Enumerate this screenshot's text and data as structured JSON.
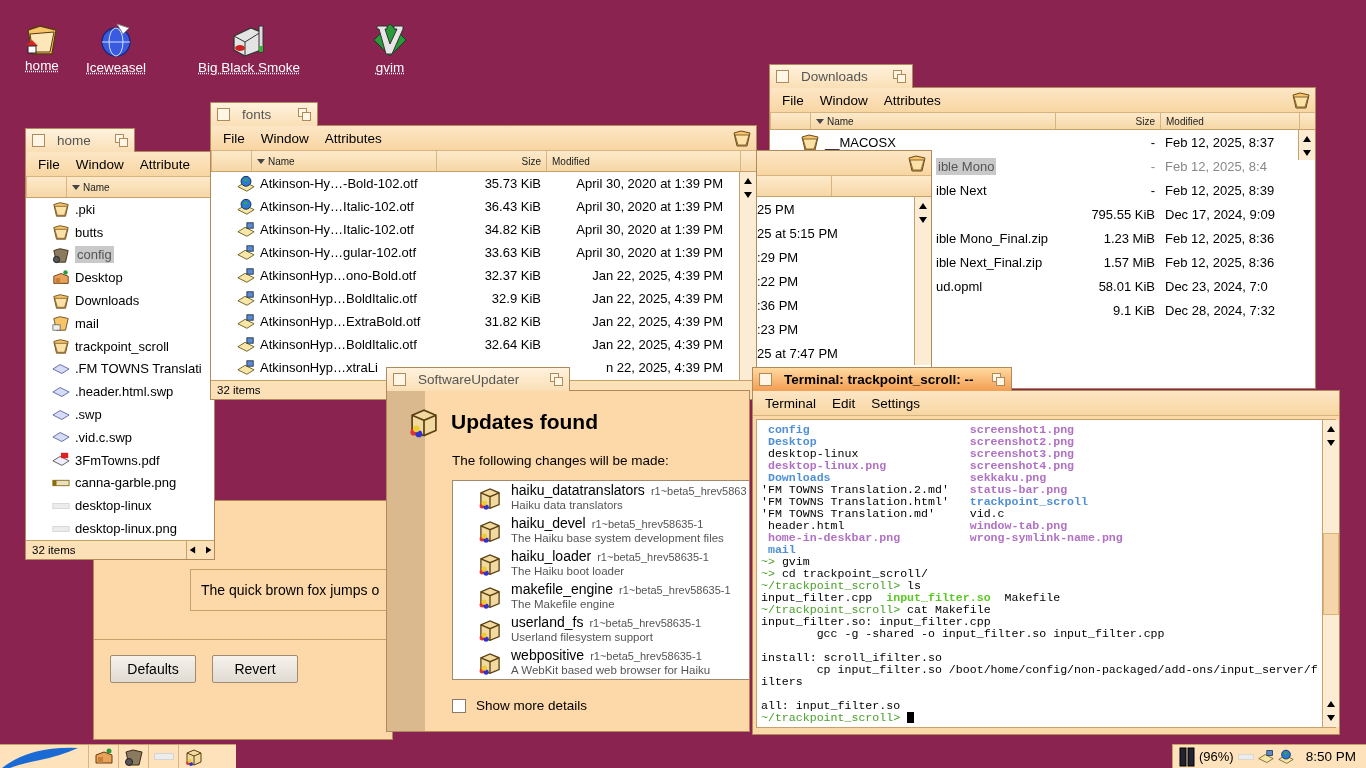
{
  "desktop_icons": [
    {
      "label": "home",
      "kind": "home-folder"
    },
    {
      "label": "Iceweasel",
      "kind": "globe"
    },
    {
      "label": "Big Black Smoke",
      "kind": "drive"
    },
    {
      "label": "gvim",
      "kind": "vim"
    }
  ],
  "font_window": {
    "sample_text": "The quick brown fox jumps o",
    "buttons": [
      "Defaults",
      "Revert"
    ]
  },
  "home_window": {
    "title": "home",
    "menu": [
      "File",
      "Window",
      "Attribute"
    ],
    "columns": [
      "Name"
    ],
    "status": "32 items",
    "items": [
      {
        "name": ".pki",
        "kind": "folder",
        "selected": false
      },
      {
        "name": "butts",
        "kind": "folder",
        "selected": false
      },
      {
        "name": "config",
        "kind": "gear-folder",
        "selected": true
      },
      {
        "name": "Desktop",
        "kind": "desk",
        "selected": false
      },
      {
        "name": "Downloads",
        "kind": "folder",
        "selected": false
      },
      {
        "name": "mail",
        "kind": "mail-folder",
        "selected": false
      },
      {
        "name": "trackpoint_scroll",
        "kind": "folder",
        "selected": false
      },
      {
        "name": ".FM TOWNS Translati",
        "kind": "document",
        "selected": false
      },
      {
        "name": ".header.html.swp",
        "kind": "document",
        "selected": false
      },
      {
        "name": ".swp",
        "kind": "document",
        "selected": false
      },
      {
        "name": ".vid.c.swp",
        "kind": "document",
        "selected": false
      },
      {
        "name": "3FmTowns.pdf",
        "kind": "pdf",
        "selected": false
      },
      {
        "name": "canna-garble.png",
        "kind": "image",
        "selected": false
      },
      {
        "name": "desktop-linux",
        "kind": "blank",
        "selected": false
      },
      {
        "name": "desktop-linux.png",
        "kind": "blank",
        "selected": false
      }
    ]
  },
  "downloads_window": {
    "title": "Downloads",
    "menu": [
      "File",
      "Window",
      "Attributes"
    ],
    "columns": [
      "Name",
      "Size",
      "Modified"
    ],
    "rows": [
      {
        "name": "__MACOSX",
        "kind": "folder",
        "size": "-",
        "modified": "Feb 12, 2025, 8:37",
        "selected": false
      },
      {
        "name": "ible Mono",
        "kind": "covered",
        "size": "-",
        "modified": "Feb 12, 2025, 8:4",
        "selected": true
      },
      {
        "name": "ible Next",
        "kind": "covered",
        "size": "-",
        "modified": "Feb 12, 2025, 8:39",
        "selected": false
      },
      {
        "kind": "covered",
        "size": "795.55 KiB",
        "modified": "Dec 17, 2024, 9:09",
        "selected": false
      },
      {
        "name": "ible Mono_Final.zip",
        "kind": "covered",
        "size": "1.23 MiB",
        "modified": "Feb 12, 2025, 8:36",
        "selected": false
      },
      {
        "name": "ible Next_Final.zip",
        "kind": "covered",
        "size": "1.57 MiB",
        "modified": "Feb 12, 2025, 8:36",
        "selected": false
      },
      {
        "name": "ud.opml",
        "kind": "covered",
        "size": "58.01 KiB",
        "modified": "Dec 23, 2024, 7:0",
        "selected": false
      },
      {
        "kind": "covered",
        "size": "9.1 KiB",
        "modified": "Dec 28, 2024, 7:32",
        "selected": false
      }
    ]
  },
  "background_window": {
    "rows": [
      "25 PM",
      "25 at 5:15 PM",
      ":29 PM",
      ":22 PM",
      ":36 PM",
      ":23 PM",
      "25 at 7:47 PM"
    ]
  },
  "fonts_window": {
    "title": "fonts",
    "menu": [
      "File",
      "Window",
      "Attributes"
    ],
    "columns": [
      "Name",
      "Size",
      "Modified"
    ],
    "status": "32 items",
    "rows": [
      {
        "name": "Atkinson-Hy…-Bold-102.otf",
        "kind": "globe-file",
        "size": "35.73 KiB",
        "modified": "April 30, 2020 at 1:39 PM"
      },
      {
        "name": "Atkinson-Hy…Italic-102.otf",
        "kind": "globe-file",
        "size": "36.43 KiB",
        "modified": "April 30, 2020 at 1:39 PM"
      },
      {
        "name": "Atkinson-Hy…Italic-102.otf",
        "kind": "font-file",
        "size": "34.82 KiB",
        "modified": "April 30, 2020 at 1:39 PM"
      },
      {
        "name": "Atkinson-Hy…gular-102.otf",
        "kind": "font-file",
        "size": "33.63 KiB",
        "modified": "April 30, 2020 at 1:39 PM"
      },
      {
        "name": "AtkinsonHyp…ono-Bold.otf",
        "kind": "font-file",
        "size": "32.37 KiB",
        "modified": "Jan 22, 2025, 4:39 PM"
      },
      {
        "name": "AtkinsonHyp…BoldItalic.otf",
        "kind": "font-file",
        "size": "32.9 KiB",
        "modified": "Jan 22, 2025, 4:39 PM"
      },
      {
        "name": "AtkinsonHyp…ExtraBold.otf",
        "kind": "font-file",
        "size": "31.82 KiB",
        "modified": "Jan 22, 2025, 4:39 PM"
      },
      {
        "name": "AtkinsonHyp…BoldItalic.otf",
        "kind": "font-file",
        "size": "32.64 KiB",
        "modified": "Jan 22, 2025, 4:39 PM"
      },
      {
        "name": "AtkinsonHyp…xtraLi",
        "kind": "font-file",
        "modified": "n 22, 2025, 4:39 PM"
      }
    ]
  },
  "software_updater": {
    "title": "SoftwareUpdater",
    "heading": "Updates found",
    "subtitle": "The following changes will be made:",
    "show_details": {
      "label": "Show more details",
      "checked": false
    },
    "packages": [
      {
        "name": "haiku_datatranslators",
        "version": "r1~beta5_hrev5863",
        "description": "Haiku data translators"
      },
      {
        "name": "haiku_devel",
        "version": "r1~beta5_hrev58635-1",
        "description": "The Haiku base system development files"
      },
      {
        "name": "haiku_loader",
        "version": "r1~beta5_hrev58635-1",
        "description": "The Haiku boot loader"
      },
      {
        "name": "makefile_engine",
        "version": "r1~beta5_hrev58635-1",
        "description": "The Makefile engine"
      },
      {
        "name": "userland_fs",
        "version": "r1~beta5_hrev58635-1",
        "description": "Userland filesystem support"
      },
      {
        "name": "webpositive",
        "version": "r1~beta5_hrev58635-1",
        "description": "A WebKit based web browser for Haiku"
      }
    ]
  },
  "terminal": {
    "title": "Terminal: trackpoint_scroll: --",
    "menu": [
      "Terminal",
      "Edit",
      "Settings"
    ],
    "listing": [
      {
        "left": {
          "text": "config",
          "kind": "dir"
        },
        "right": {
          "text": "screenshot1.png",
          "kind": "image"
        }
      },
      {
        "left": {
          "text": "Desktop",
          "kind": "dir"
        },
        "right": {
          "text": "screenshot2.png",
          "kind": "image"
        }
      },
      {
        "left": {
          "text": "desktop-linux",
          "kind": "plain"
        },
        "right": {
          "text": "screenshot3.png",
          "kind": "image"
        }
      },
      {
        "left": {
          "text": "desktop-linux.png",
          "kind": "image"
        },
        "right": {
          "text": "screenshot4.png",
          "kind": "image"
        }
      },
      {
        "left": {
          "text": "Downloads",
          "kind": "dir"
        },
        "right": {
          "text": "sekkaku.png",
          "kind": "image"
        }
      },
      {
        "left": {
          "text": "'FM TOWNS Translation.2.md'",
          "kind": "quoted"
        },
        "right": {
          "text": "status-bar.png",
          "kind": "image"
        }
      },
      {
        "left": {
          "text": "'FM TOWNS Translation.html'",
          "kind": "quoted"
        },
        "right": {
          "text": "trackpoint_scroll",
          "kind": "dir"
        }
      },
      {
        "left": {
          "text": "'FM TOWNS Translation.md'",
          "kind": "quoted"
        },
        "right": {
          "text": "vid.c",
          "kind": "plain"
        }
      },
      {
        "left": {
          "text": "header.html",
          "kind": "plain"
        },
        "right": {
          "text": "window-tab.png",
          "kind": "image"
        }
      },
      {
        "left": {
          "text": "home-in-deskbar.png",
          "kind": "image"
        },
        "right": {
          "text": "wrong-symlink-name.png",
          "kind": "image"
        }
      },
      {
        "left": {
          "text": "mail",
          "kind": "dir"
        }
      }
    ],
    "lines": [
      {
        "kind": "text",
        "segments": [
          {
            "text": "~>",
            "kind": "prompt"
          },
          {
            "text": " gvim",
            "kind": "plain"
          }
        ]
      },
      {
        "kind": "text",
        "segments": [
          {
            "text": "~>",
            "kind": "prompt"
          },
          {
            "text": " cd trackpoint_scroll/",
            "kind": "plain"
          }
        ]
      },
      {
        "kind": "text",
        "segments": [
          {
            "text": "~/trackpoint_scroll>",
            "kind": "prompt"
          },
          {
            "text": " ls",
            "kind": "plain"
          }
        ]
      },
      {
        "kind": "text",
        "segments": [
          {
            "text": "input_filter.cpp  ",
            "kind": "plain"
          },
          {
            "text": "input_filter.so",
            "kind": "exec"
          },
          {
            "text": "  Makefile",
            "kind": "plain"
          }
        ]
      },
      {
        "kind": "text",
        "segments": [
          {
            "text": "~/trackpoint_scroll>",
            "kind": "prompt"
          },
          {
            "text": " cat Makefile",
            "kind": "plain"
          }
        ]
      },
      {
        "kind": "text",
        "segments": [
          {
            "text": "input_filter.so: input_filter.cpp",
            "kind": "plain"
          }
        ]
      },
      {
        "kind": "text",
        "segments": [
          {
            "text": "        gcc -g -shared -o input_filter.so input_filter.cpp",
            "kind": "plain"
          }
        ]
      },
      {
        "kind": "blank"
      },
      {
        "kind": "text",
        "segments": [
          {
            "text": "install: scroll_ifilter.so",
            "kind": "plain"
          }
        ]
      },
      {
        "kind": "text",
        "segments": [
          {
            "text": "        cp input_filter.so /boot/home/config/non-packaged/add-ons/input_server/f",
            "kind": "plain"
          }
        ]
      },
      {
        "kind": "text",
        "segments": [
          {
            "text": "ilters",
            "kind": "plain"
          }
        ]
      },
      {
        "kind": "blank"
      },
      {
        "kind": "text",
        "segments": [
          {
            "text": "all: input_filter.so",
            "kind": "plain"
          }
        ]
      },
      {
        "kind": "prompt",
        "segments": [
          {
            "text": "~/trackpoint_scroll>",
            "kind": "prompt"
          }
        ]
      }
    ]
  },
  "deskbar": {
    "battery": "(96%)",
    "clock": "8:50 PM"
  }
}
